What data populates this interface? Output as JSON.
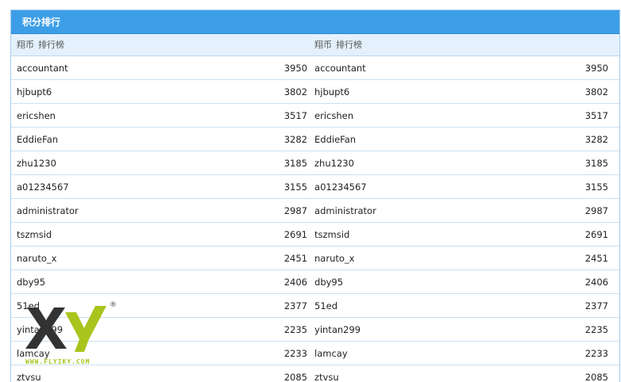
{
  "panel": {
    "title": "积分排行"
  },
  "columns": [
    {
      "currency": "翔币",
      "label": "排行榜",
      "rows": [
        {
          "name": "accountant",
          "score": "3950"
        },
        {
          "name": "hjbupt6",
          "score": "3802"
        },
        {
          "name": "ericshen",
          "score": "3517"
        },
        {
          "name": "EddieFan",
          "score": "3282"
        },
        {
          "name": "zhu1230",
          "score": "3185"
        },
        {
          "name": "a01234567",
          "score": "3155"
        },
        {
          "name": "administrator",
          "score": "2987"
        },
        {
          "name": "tszmsid",
          "score": "2691"
        },
        {
          "name": "naruto_x",
          "score": "2451"
        },
        {
          "name": "dby95",
          "score": "2406"
        },
        {
          "name": "51ed",
          "score": "2377"
        },
        {
          "name": "yintan299",
          "score": "2235"
        },
        {
          "name": "lamcay",
          "score": "2233"
        },
        {
          "name": "ztvsu",
          "score": "2085"
        }
      ]
    },
    {
      "currency": "翔币",
      "label": "排行榜",
      "rows": [
        {
          "name": "accountant",
          "score": "3950"
        },
        {
          "name": "hjbupt6",
          "score": "3802"
        },
        {
          "name": "ericshen",
          "score": "3517"
        },
        {
          "name": "EddieFan",
          "score": "3282"
        },
        {
          "name": "zhu1230",
          "score": "3185"
        },
        {
          "name": "a01234567",
          "score": "3155"
        },
        {
          "name": "administrator",
          "score": "2987"
        },
        {
          "name": "tszmsid",
          "score": "2691"
        },
        {
          "name": "naruto_x",
          "score": "2451"
        },
        {
          "name": "dby95",
          "score": "2406"
        },
        {
          "name": "51ed",
          "score": "2377"
        },
        {
          "name": "yintan299",
          "score": "2235"
        },
        {
          "name": "lamcay",
          "score": "2233"
        },
        {
          "name": "ztvsu",
          "score": "2085"
        }
      ]
    }
  ],
  "watermark": {
    "url": "WWW.FLYIKY.COM",
    "registered": "®"
  },
  "colors": {
    "header_bg": "#3d9ee8",
    "subhead_bg": "#e4f1fc",
    "row_border": "#c9e0f4",
    "logo_x": "#333333",
    "logo_y": "#a9c41d"
  }
}
